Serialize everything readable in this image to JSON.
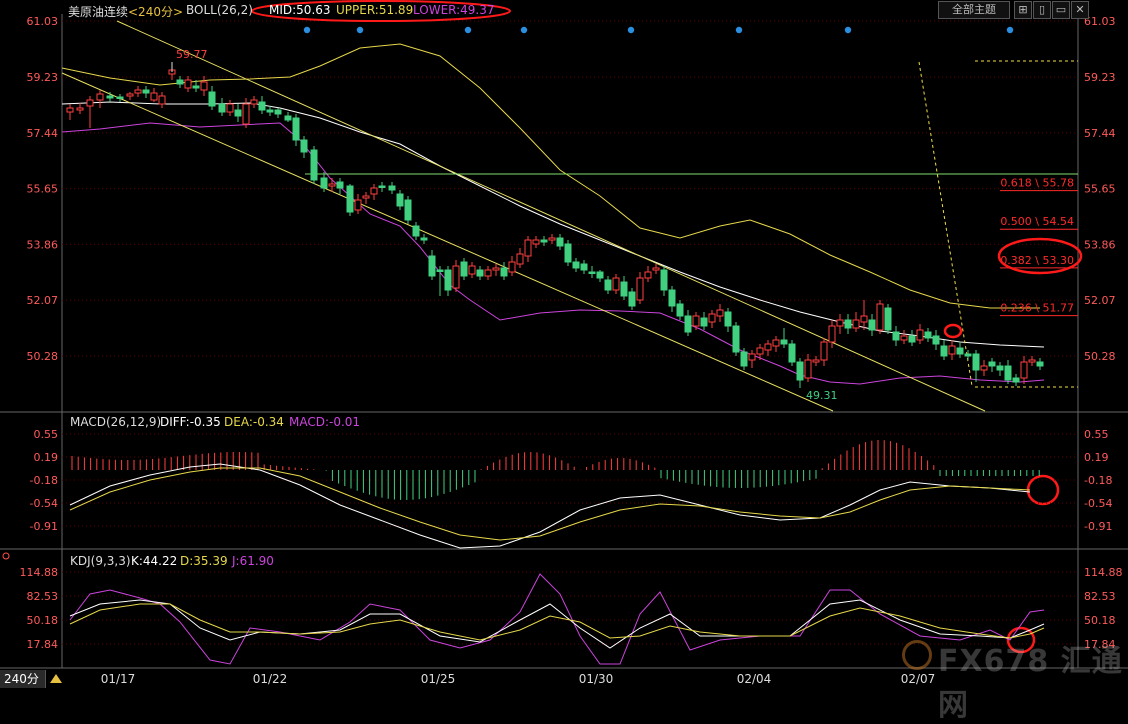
{
  "colors": {
    "bg": "#000000",
    "grid": "#5a0000",
    "up": "#ff4040",
    "down": "#40d080",
    "mid": "#ffffff",
    "upper": "#e6d84a",
    "lower": "#cc44dd",
    "fib": "#ff2a2a",
    "annot": "#ff1a1a"
  },
  "header": {
    "symbol": "美原油连续",
    "period_tag": "<240分>",
    "boll_label": "BOLL(26,2)",
    "mid": "MID:50.63",
    "upper": "UPPER:51.89",
    "lower": "LOWER:49.37",
    "theme_button": "全部主题",
    "win_buttons": [
      "⊞",
      "▯",
      "▭",
      "✕"
    ]
  },
  "price_axis": {
    "ticks": [
      "61.03",
      "59.23",
      "57.44",
      "55.65",
      "53.86",
      "52.07",
      "50.28"
    ]
  },
  "macd": {
    "label": "MACD(26,12,9)",
    "diff": "DIFF:-0.35",
    "dea": "DEA:-0.34",
    "macd": "MACD:-0.01",
    "ticks": [
      "0.55",
      "0.19",
      "-0.18",
      "-0.54",
      "-0.91"
    ]
  },
  "kdj": {
    "label": "KDJ(9,3,3)",
    "k": "K:44.22",
    "d": "D:35.39",
    "j": "J:61.90",
    "ticks": [
      "114.88",
      "82.53",
      "50.18",
      "17.84"
    ]
  },
  "price_labels": {
    "high": "59.77",
    "low": "49.31"
  },
  "fib_levels": [
    {
      "label": "0.618 \\ 55.78",
      "price": 55.78
    },
    {
      "label": "0.500 \\ 54.54",
      "price": 54.54
    },
    {
      "label": "0.382 \\ 53.30",
      "price": 53.3
    },
    {
      "label": "0.236 \\ 51.77",
      "price": 51.77
    }
  ],
  "date_axis": [
    "01/17",
    "01/22",
    "01/25",
    "01/30",
    "02/04",
    "02/07"
  ],
  "period_button": "240分",
  "watermark": "FX678 汇通网"
}
